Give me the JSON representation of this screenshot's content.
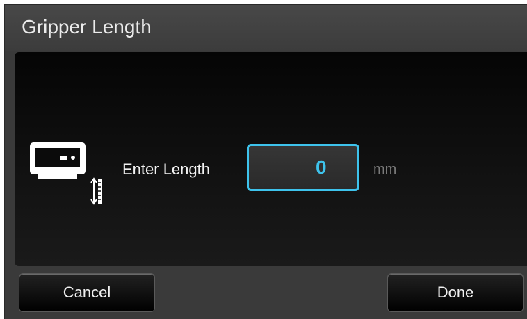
{
  "dialog": {
    "title": "Gripper Length"
  },
  "form": {
    "icon": "gripper-length-icon",
    "label": "Enter Length",
    "value": "0",
    "unit": "mm"
  },
  "footer": {
    "cancel_label": "Cancel",
    "done_label": "Done"
  },
  "colors": {
    "accent": "#3ec3ec",
    "panel": "#3a3a3a",
    "content_bg": "#0a0a0a"
  }
}
